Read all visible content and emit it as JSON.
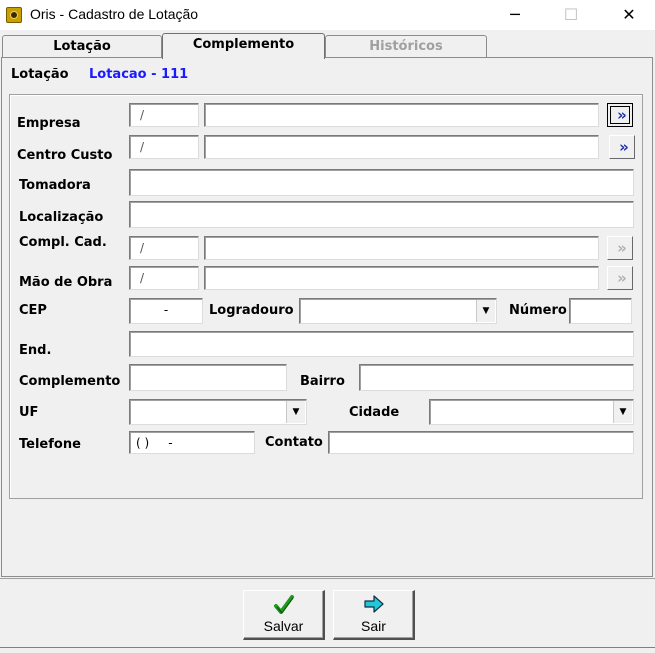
{
  "window": {
    "title": "Oris - Cadastro de Lotação",
    "minimize": "─",
    "maximize": "☐",
    "close": "✕"
  },
  "tabs": [
    {
      "label": "Lotação",
      "state": "normal"
    },
    {
      "label": "Complemento",
      "state": "active"
    },
    {
      "label": "Históricos",
      "state": "disabled"
    }
  ],
  "header": {
    "label": "Lotação",
    "value": "Lotacao - 111",
    "value_color": "#1a1aff"
  },
  "form": {
    "empresa": {
      "label": "Empresa",
      "code": "/",
      "desc": ""
    },
    "centro_custo": {
      "label": "Centro Custo",
      "code": "/",
      "desc": ""
    },
    "tomadora": {
      "label": "Tomadora",
      "value": ""
    },
    "localizacao": {
      "label": "Localização",
      "value": ""
    },
    "compl_cad": {
      "label": "Compl. Cad.",
      "code": "/",
      "desc": ""
    },
    "mao_de_obra": {
      "label": "Mão de Obra",
      "code": "/",
      "desc": ""
    },
    "cep": {
      "label": "CEP",
      "value": "-"
    },
    "logradouro": {
      "label": "Logradouro",
      "value": ""
    },
    "numero": {
      "label": "Número",
      "value": ""
    },
    "end": {
      "label": "End.",
      "value": ""
    },
    "complemento": {
      "label": "Complemento",
      "value": ""
    },
    "bairro": {
      "label": "Bairro",
      "value": ""
    },
    "uf": {
      "label": "UF",
      "value": ""
    },
    "cidade": {
      "label": "Cidade",
      "value": ""
    },
    "telefone": {
      "label": "Telefone",
      "value": "( )     -"
    },
    "contato": {
      "label": "Contato",
      "value": ""
    },
    "lookup_glyph": "»",
    "dropdown_glyph": "▼"
  },
  "buttons": {
    "salvar": {
      "label": "Salvar",
      "icon": "checkmark-icon",
      "icon_color": "#1e9a1e"
    },
    "sair": {
      "label": "Sair",
      "icon": "arrow-right-icon",
      "icon_color": "#20b8c8"
    }
  }
}
